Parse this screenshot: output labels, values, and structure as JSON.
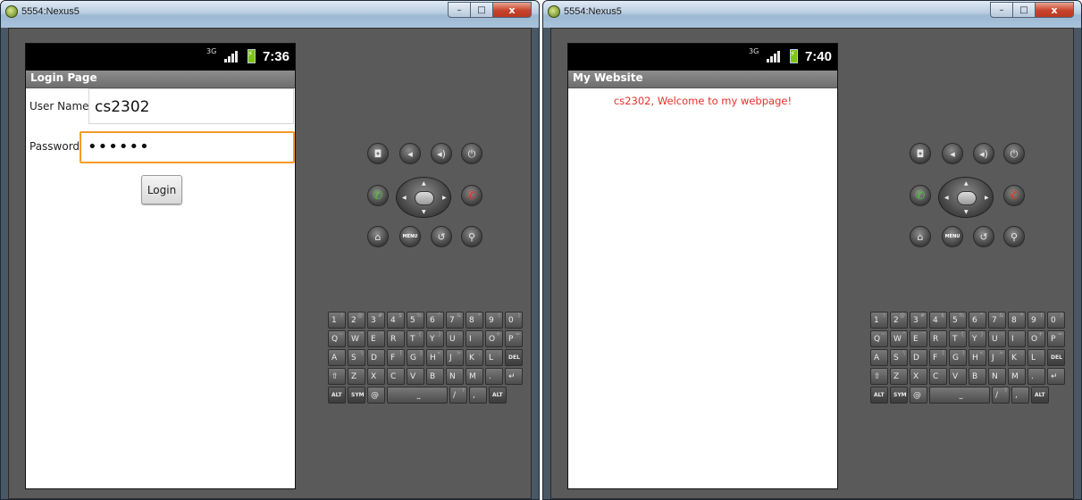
{
  "left_window": {
    "title": "5554:Nexus5",
    "status": {
      "network": "3G",
      "time": "7:36"
    },
    "app_title": "Login Page",
    "username_label": "User Name",
    "username_value": "cs2302",
    "password_label": "Password",
    "password_mask": "••••••",
    "login_button": "Login"
  },
  "right_window": {
    "title": "5554:Nexus5",
    "status": {
      "network": "3G",
      "time": "7:40"
    },
    "app_title": "My Website",
    "welcome": "cs2302, Welcome to my webpage!"
  },
  "window_controls": {
    "minimize": "–",
    "maximize": "□",
    "close": "x"
  },
  "hardware_buttons": {
    "row1": [
      "camera-icon",
      "volume-down-icon",
      "volume-up-icon",
      "power-icon"
    ],
    "call": "call-icon",
    "end_call": "end-call-icon",
    "row3": [
      "home-icon",
      "menu-icon",
      "back-icon",
      "search-icon"
    ],
    "menu_label": "MENU"
  },
  "keyboard": {
    "row1": [
      {
        "k": "1",
        "s": "!"
      },
      {
        "k": "2",
        "s": "@"
      },
      {
        "k": "3",
        "s": "#"
      },
      {
        "k": "4",
        "s": "$"
      },
      {
        "k": "5",
        "s": "%"
      },
      {
        "k": "6",
        "s": "^"
      },
      {
        "k": "7",
        "s": "&"
      },
      {
        "k": "8",
        "s": "*"
      },
      {
        "k": "9",
        "s": "("
      },
      {
        "k": "0",
        "s": ")"
      }
    ],
    "row2": [
      {
        "k": "Q",
        "s": "~"
      },
      {
        "k": "W",
        "s": "\""
      },
      {
        "k": "E",
        "s": "'"
      },
      {
        "k": "R",
        "s": ""
      },
      {
        "k": "T",
        "s": "{"
      },
      {
        "k": "Y",
        "s": "}"
      },
      {
        "k": "U",
        "s": "-"
      },
      {
        "k": "I",
        "s": ""
      },
      {
        "k": "O",
        "s": "+"
      },
      {
        "k": "P",
        "s": "="
      }
    ],
    "row3": [
      {
        "k": "A",
        "s": ""
      },
      {
        "k": "S",
        "s": "\\"
      },
      {
        "k": "D",
        "s": ""
      },
      {
        "k": "F",
        "s": "["
      },
      {
        "k": "G",
        "s": "]"
      },
      {
        "k": "H",
        "s": "<"
      },
      {
        "k": "J",
        "s": ">"
      },
      {
        "k": "K",
        "s": ";"
      },
      {
        "k": "L",
        "s": ":"
      },
      {
        "k": "DEL",
        "s": ""
      }
    ],
    "row4": [
      {
        "k": "⇧",
        "s": ""
      },
      {
        "k": "Z",
        "s": ""
      },
      {
        "k": "X",
        "s": ""
      },
      {
        "k": "C",
        "s": ""
      },
      {
        "k": "V",
        "s": ""
      },
      {
        "k": "B",
        "s": ""
      },
      {
        "k": "N",
        "s": ""
      },
      {
        "k": "M",
        "s": ""
      },
      {
        "k": ".",
        "s": ""
      },
      {
        "k": "↵",
        "s": ""
      }
    ],
    "row5": [
      {
        "k": "ALT",
        "s": ""
      },
      {
        "k": "SYM",
        "s": ""
      },
      {
        "k": "@",
        "s": ""
      },
      {
        "k": "⎵",
        "s": ""
      },
      {
        "k": "/",
        "s": "?"
      },
      {
        "k": ",",
        "s": ""
      },
      {
        "k": "ALT",
        "s": ""
      }
    ]
  }
}
